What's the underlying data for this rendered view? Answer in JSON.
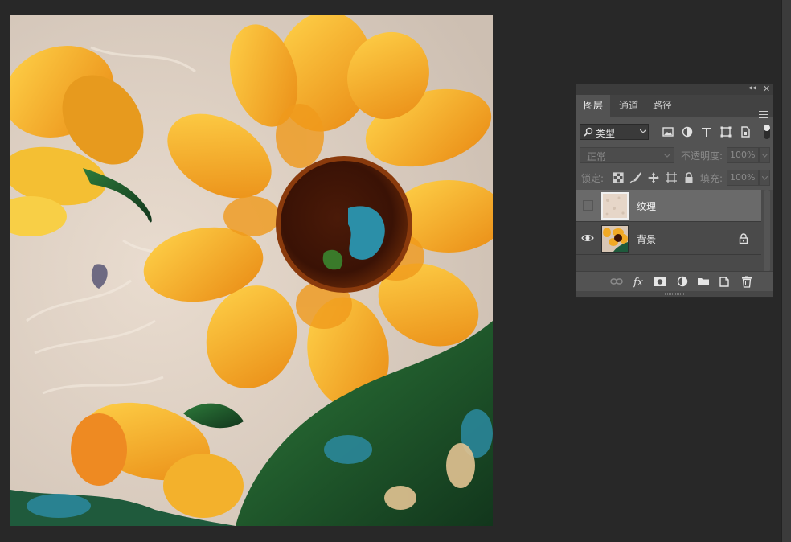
{
  "panel": {
    "tabs": [
      {
        "label": "图层",
        "active": true
      },
      {
        "label": "通道",
        "active": false
      },
      {
        "label": "路径",
        "active": false
      }
    ],
    "collapse_icon": "double-chevron-left",
    "close_icon": "close-x",
    "menu_icon": "hamburger-menu"
  },
  "filter": {
    "kind_label": "类型",
    "search_icon": "search",
    "icons": [
      "image-filter",
      "adjustment-filter",
      "type-filter",
      "shape-filter",
      "smart-object-filter"
    ],
    "toggle_on": true
  },
  "blend": {
    "mode": "正常",
    "opacity_label": "不透明度:",
    "opacity_value": "100%",
    "enabled": false
  },
  "lock": {
    "label": "锁定:",
    "icons": [
      "lock-transparent-pixels",
      "lock-image-pixels",
      "lock-position",
      "lock-artboard",
      "lock-all"
    ],
    "fill_label": "填充:",
    "fill_value": "100%"
  },
  "layers": [
    {
      "name": "纹理",
      "visible": false,
      "selected": true,
      "thumb": "texture"
    },
    {
      "name": "背景",
      "visible": true,
      "selected": false,
      "locked": true,
      "thumb": "sunflower"
    }
  ],
  "bottom_icons": [
    "link-layers",
    "layer-style-fx",
    "add-mask",
    "new-adjustment-layer",
    "new-group",
    "new-layer",
    "delete-layer"
  ],
  "colors": {
    "workspace": "#282828",
    "panel_bg": "#535353",
    "selected_row": "#6a6a6a"
  }
}
